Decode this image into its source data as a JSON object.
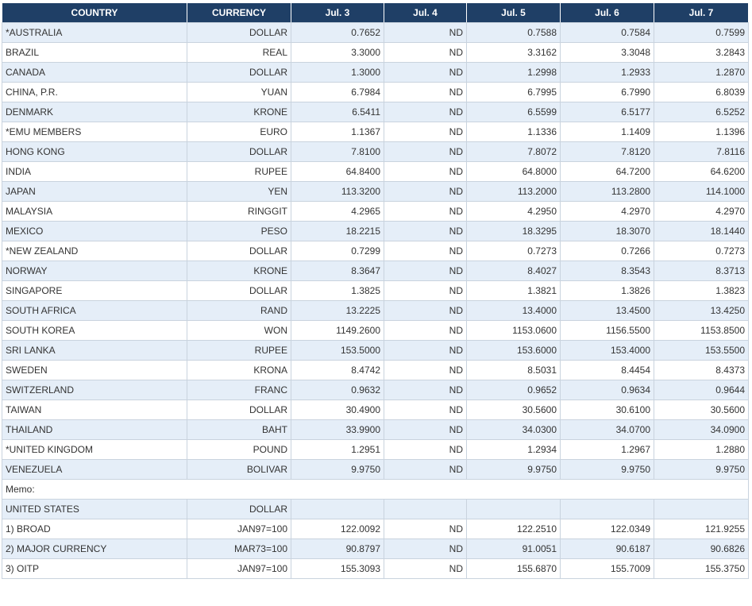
{
  "headers": [
    "COUNTRY",
    "CURRENCY",
    "Jul. 3",
    "Jul. 4",
    "Jul. 5",
    "Jul. 6",
    "Jul. 7"
  ],
  "rows": [
    [
      "*AUSTRALIA",
      "DOLLAR",
      "0.7652",
      "ND",
      "0.7588",
      "0.7584",
      "0.7599"
    ],
    [
      "BRAZIL",
      "REAL",
      "3.3000",
      "ND",
      "3.3162",
      "3.3048",
      "3.2843"
    ],
    [
      "CANADA",
      "DOLLAR",
      "1.3000",
      "ND",
      "1.2998",
      "1.2933",
      "1.2870"
    ],
    [
      "CHINA, P.R.",
      "YUAN",
      "6.7984",
      "ND",
      "6.7995",
      "6.7990",
      "6.8039"
    ],
    [
      "DENMARK",
      "KRONE",
      "6.5411",
      "ND",
      "6.5599",
      "6.5177",
      "6.5252"
    ],
    [
      "*EMU MEMBERS",
      "EURO",
      "1.1367",
      "ND",
      "1.1336",
      "1.1409",
      "1.1396"
    ],
    [
      "HONG KONG",
      "DOLLAR",
      "7.8100",
      "ND",
      "7.8072",
      "7.8120",
      "7.8116"
    ],
    [
      "INDIA",
      "RUPEE",
      "64.8400",
      "ND",
      "64.8000",
      "64.7200",
      "64.6200"
    ],
    [
      "JAPAN",
      "YEN",
      "113.3200",
      "ND",
      "113.2000",
      "113.2800",
      "114.1000"
    ],
    [
      "MALAYSIA",
      "RINGGIT",
      "4.2965",
      "ND",
      "4.2950",
      "4.2970",
      "4.2970"
    ],
    [
      "MEXICO",
      "PESO",
      "18.2215",
      "ND",
      "18.3295",
      "18.3070",
      "18.1440"
    ],
    [
      "*NEW ZEALAND",
      "DOLLAR",
      "0.7299",
      "ND",
      "0.7273",
      "0.7266",
      "0.7273"
    ],
    [
      "NORWAY",
      "KRONE",
      "8.3647",
      "ND",
      "8.4027",
      "8.3543",
      "8.3713"
    ],
    [
      "SINGAPORE",
      "DOLLAR",
      "1.3825",
      "ND",
      "1.3821",
      "1.3826",
      "1.3823"
    ],
    [
      "SOUTH AFRICA",
      "RAND",
      "13.2225",
      "ND",
      "13.4000",
      "13.4500",
      "13.4250"
    ],
    [
      "SOUTH KOREA",
      "WON",
      "1149.2600",
      "ND",
      "1153.0600",
      "1156.5500",
      "1153.8500"
    ],
    [
      "SRI LANKA",
      "RUPEE",
      "153.5000",
      "ND",
      "153.6000",
      "153.4000",
      "153.5500"
    ],
    [
      "SWEDEN",
      "KRONA",
      "8.4742",
      "ND",
      "8.5031",
      "8.4454",
      "8.4373"
    ],
    [
      "SWITZERLAND",
      "FRANC",
      "0.9632",
      "ND",
      "0.9652",
      "0.9634",
      "0.9644"
    ],
    [
      "TAIWAN",
      "DOLLAR",
      "30.4900",
      "ND",
      "30.5600",
      "30.6100",
      "30.5600"
    ],
    [
      "THAILAND",
      "BAHT",
      "33.9900",
      "ND",
      "34.0300",
      "34.0700",
      "34.0900"
    ],
    [
      "*UNITED KINGDOM",
      "POUND",
      "1.2951",
      "ND",
      "1.2934",
      "1.2967",
      "1.2880"
    ],
    [
      "VENEZUELA",
      "BOLIVAR",
      "9.9750",
      "ND",
      "9.9750",
      "9.9750",
      "9.9750"
    ]
  ],
  "memo_label": "Memo:",
  "memo_rows": [
    [
      "UNITED STATES",
      "DOLLAR",
      "",
      "",
      "",
      "",
      ""
    ],
    [
      "1) BROAD",
      "JAN97=100",
      "122.0092",
      "ND",
      "122.2510",
      "122.0349",
      "121.9255"
    ],
    [
      "2) MAJOR CURRENCY",
      "MAR73=100",
      "90.8797",
      "ND",
      "91.0051",
      "90.6187",
      "90.6826"
    ],
    [
      "3) OITP",
      "JAN97=100",
      "155.3093",
      "ND",
      "155.6870",
      "155.7009",
      "155.3750"
    ]
  ],
  "colors": {
    "header_bg": "#1f3f66",
    "row_alt_bg": "#e5eef8",
    "border": "#c9d3de"
  }
}
